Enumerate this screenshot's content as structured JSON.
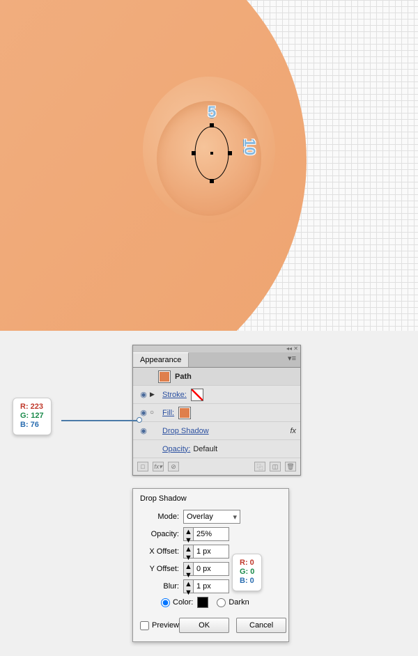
{
  "canvas": {
    "dim_h": "5",
    "dim_v": "10"
  },
  "appearance": {
    "tab": "Appearance",
    "path_label": "Path",
    "stroke_label": "Stroke:",
    "fill_label": "Fill:",
    "drop_shadow_label": "Drop Shadow",
    "opacity_label": "Opacity:",
    "opacity_value": "Default",
    "fx": "fx"
  },
  "fill_rgb": {
    "r": "R: 223",
    "g": "G: 127",
    "b": "B: 76"
  },
  "shadow_rgb": {
    "r": "R: 0",
    "g": "G: 0",
    "b": "B: 0"
  },
  "dialog": {
    "title": "Drop Shadow",
    "mode_label": "Mode:",
    "mode_value": "Overlay",
    "opacity_label": "Opacity:",
    "opacity_value": "25%",
    "xoff_label": "X Offset:",
    "xoff_value": "1 px",
    "yoff_label": "Y Offset:",
    "yoff_value": "0 px",
    "blur_label": "Blur:",
    "blur_value": "1 px",
    "color_label": "Color:",
    "darkness_label": "Darkn",
    "preview": "Preview",
    "ok": "OK",
    "cancel": "Cancel"
  }
}
